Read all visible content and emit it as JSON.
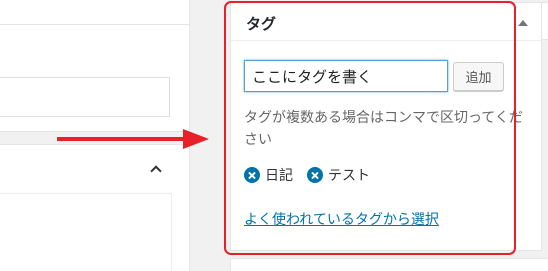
{
  "tag_box": {
    "title": "タグ",
    "input_value": "ここにタグを書く",
    "add_button_label": "追加",
    "help_text": "タグが複数ある場合はコンマで区切ってください",
    "tags": [
      {
        "label": "日記"
      },
      {
        "label": "テスト"
      }
    ],
    "choose_link": "よく使われているタグから選択"
  },
  "colors": {
    "highlight": "#e8202a",
    "arrow": "#e8202a",
    "link": "#0073aa",
    "remove_icon": "#0073aa",
    "input_focus_border": "#5b9dd9"
  },
  "icons": {
    "collapse": "caret-up-icon",
    "toggle": "triangle-up-icon",
    "remove": "remove-circle-icon",
    "pointer": "red-arrow-icon"
  }
}
